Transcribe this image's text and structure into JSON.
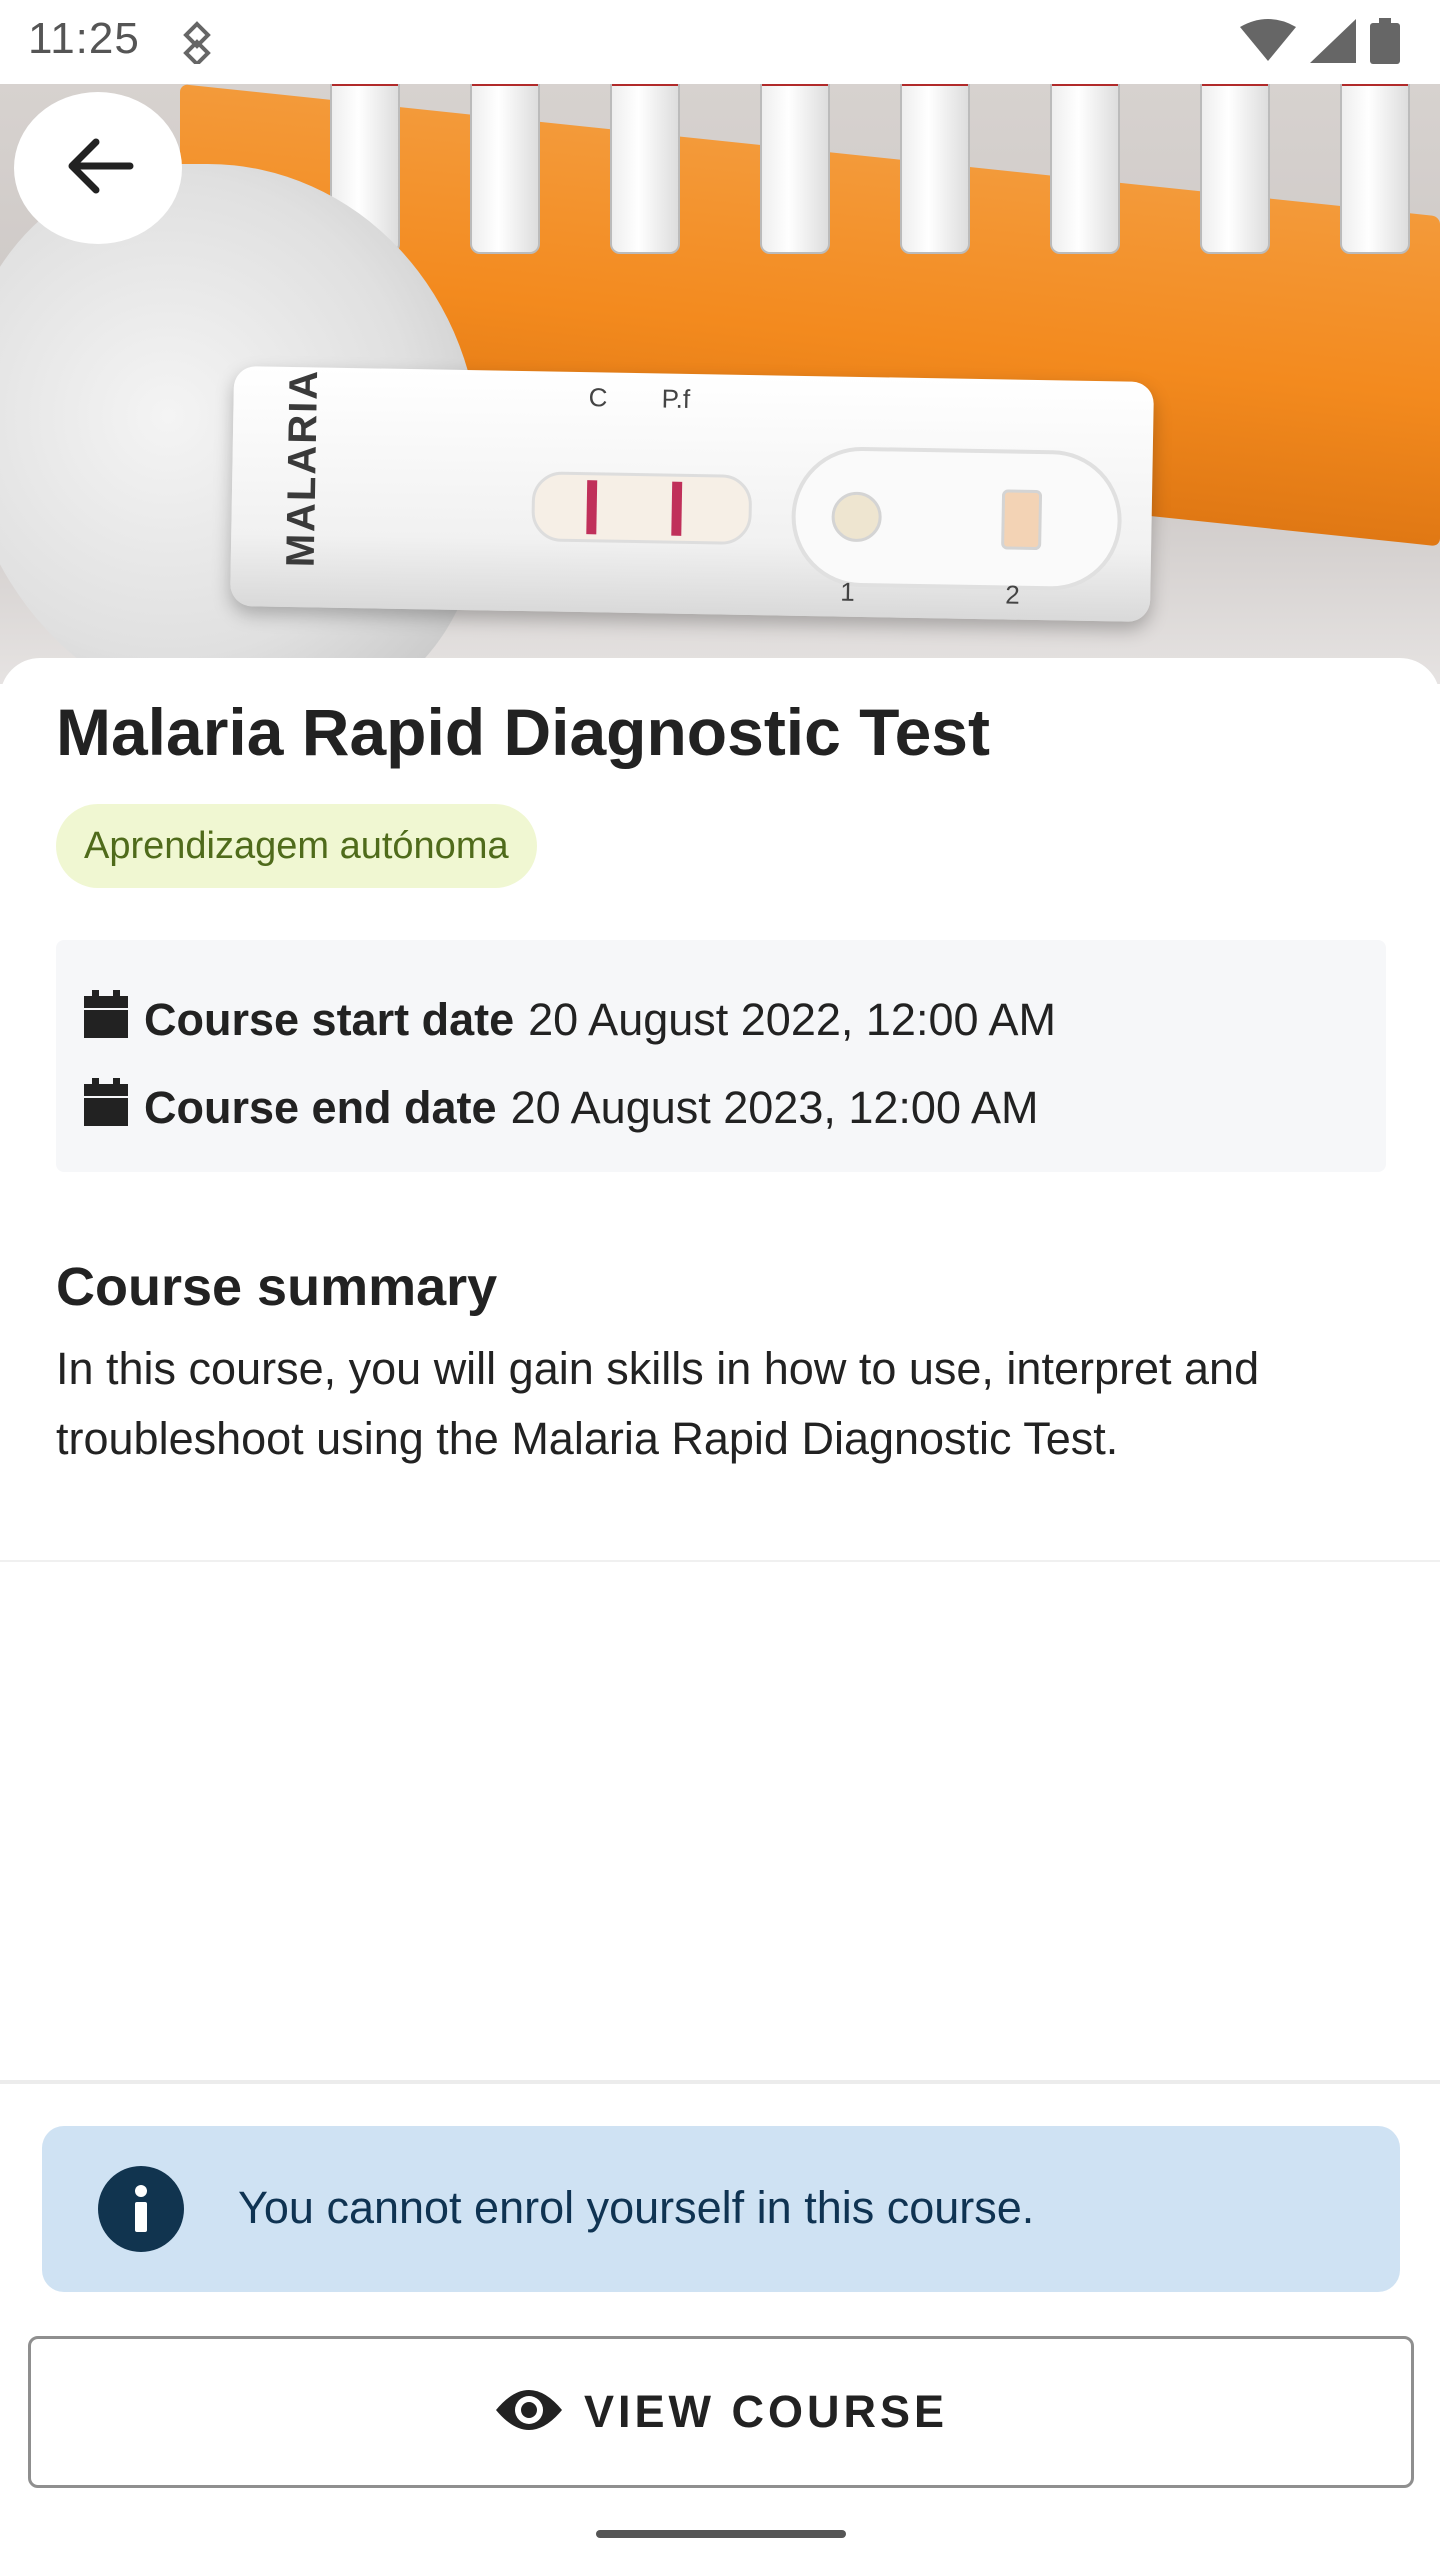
{
  "status_bar": {
    "time": "11:25",
    "icons": [
      "sync-icon",
      "wifi-icon",
      "signal-icon",
      "battery-icon"
    ]
  },
  "hero": {
    "image_text": {
      "brand": "MALARIA",
      "marker_c": "C",
      "marker_pf": "P.f",
      "marker_1": "1",
      "marker_2": "2"
    }
  },
  "course": {
    "title": "Malaria Rapid Diagnostic Test",
    "badge": "Aprendizagem autónoma",
    "start_label": "Course start date",
    "start_value": "20 August 2022, 12:00 AM",
    "end_label": "Course end date",
    "end_value": "20 August 2023, 12:00 AM",
    "summary_heading": "Course summary",
    "summary_text": "In this course, you will gain skills in how to use, interpret and troubleshoot using the Malaria Rapid Diagnostic Test."
  },
  "notice": {
    "text": "You cannot enrol yourself in this course."
  },
  "actions": {
    "view_course": "VIEW COURSE"
  },
  "colors": {
    "badge_bg": "#f0f7d2",
    "badge_text": "#4f6b1b",
    "notice_bg": "#cfe2f3",
    "notice_icon": "#11344f"
  }
}
